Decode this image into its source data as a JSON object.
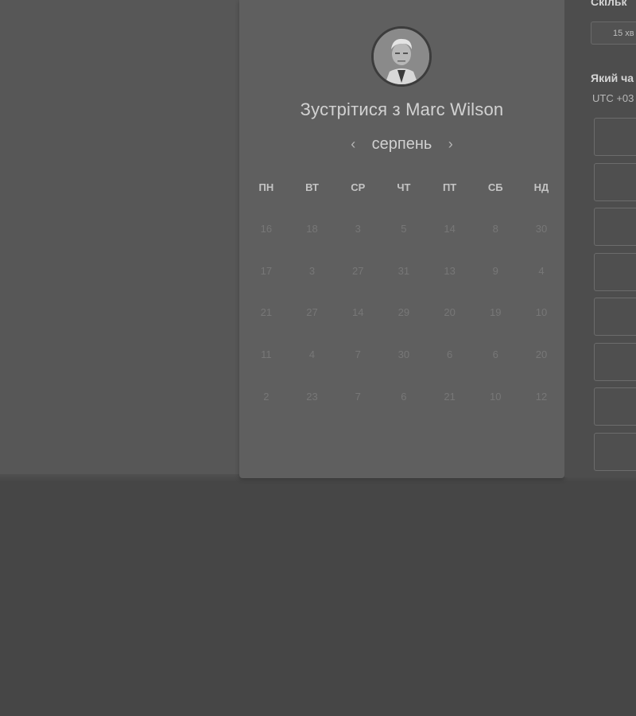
{
  "calendar": {
    "title": "Зустрітися з Marc Wilson",
    "month": "серпень",
    "prev_icon": "chevron-left-icon",
    "next_icon": "chevron-right-icon",
    "weekdays": [
      "ПН",
      "ВТ",
      "СР",
      "ЧТ",
      "ПТ",
      "СБ",
      "НД"
    ],
    "weeks": [
      [
        "16",
        "18",
        "3",
        "5",
        "14",
        "8",
        "30"
      ],
      [
        "17",
        "3",
        "27",
        "31",
        "13",
        "9",
        "4"
      ],
      [
        "21",
        "27",
        "14",
        "29",
        "20",
        "19",
        "10"
      ],
      [
        "11",
        "4",
        "7",
        "30",
        "6",
        "6",
        "20"
      ],
      [
        "2",
        "23",
        "7",
        "6",
        "21",
        "10",
        "12"
      ]
    ]
  },
  "side_panel": {
    "duration_label": "Скільк",
    "duration_value": "15 хв",
    "time_label": "Який ча",
    "timezone": "UTC +03"
  },
  "colors": {
    "background": "#464646",
    "card": "#5f5f5f",
    "panel": "#4d4d4d"
  }
}
